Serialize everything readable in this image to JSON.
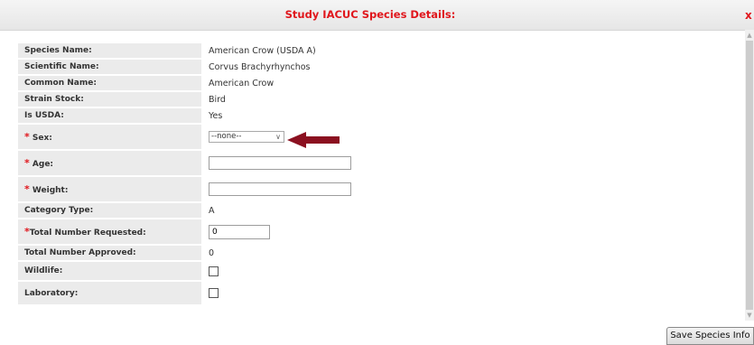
{
  "header": {
    "title": "Study IACUC Species Details:",
    "close_label": "x"
  },
  "fields": {
    "species_name": {
      "label": "Species Name:",
      "value": "American Crow (USDA A)"
    },
    "scientific_name": {
      "label": "Scientific Name:",
      "value": "Corvus Brachyrhynchos"
    },
    "common_name": {
      "label": "Common Name:",
      "value": "American Crow"
    },
    "strain_stock": {
      "label": "Strain Stock:",
      "value": "Bird"
    },
    "is_usda": {
      "label": "Is USDA:",
      "value": "Yes"
    },
    "sex": {
      "required_mark": "*",
      "label": "Sex:",
      "selected": "--none--"
    },
    "age": {
      "required_mark": "*",
      "label": "Age:",
      "value": ""
    },
    "weight": {
      "required_mark": "*",
      "label": "Weight:",
      "value": ""
    },
    "category_type": {
      "label": "Category Type:",
      "value": "A"
    },
    "total_requested": {
      "required_mark": "*",
      "label": "Total Number Requested:",
      "value": "0"
    },
    "total_approved": {
      "label": "Total Number Approved:",
      "value": "0"
    },
    "wildlife": {
      "label": "Wildlife:",
      "checked": false
    },
    "laboratory": {
      "label": "Laboratory:",
      "checked": false
    }
  },
  "annotation": {
    "arrow_color": "#8b1020"
  },
  "footer": {
    "save_label": "Save Species Info"
  },
  "colors": {
    "accent": "#e0161c",
    "label_bg": "#ebebeb"
  }
}
